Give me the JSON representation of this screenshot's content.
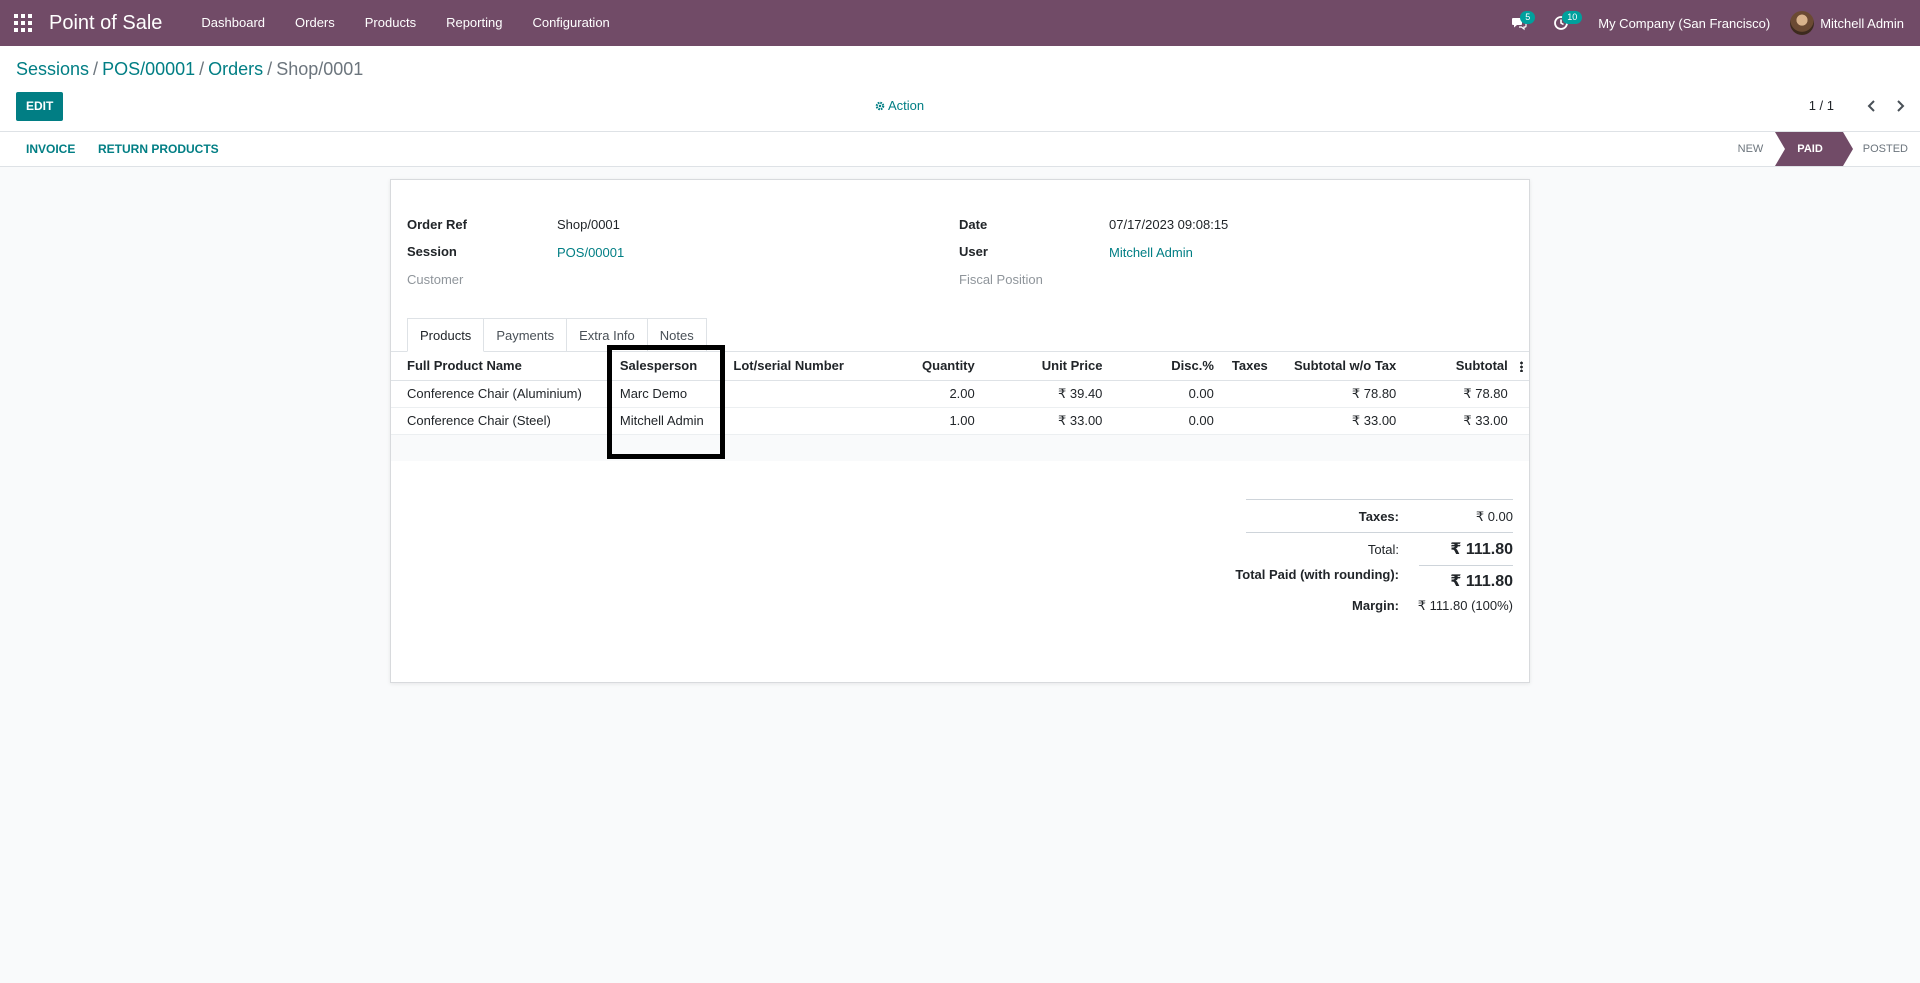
{
  "navbar": {
    "app_name": "Point of Sale",
    "menu": [
      "Dashboard",
      "Orders",
      "Products",
      "Reporting",
      "Configuration"
    ],
    "messages_count": "5",
    "activities_count": "10",
    "company": "My Company (San Francisco)",
    "user": "Mitchell Admin",
    "color": "#714b67"
  },
  "breadcrumb": {
    "items": [
      "Sessions",
      "POS/00001",
      "Orders"
    ],
    "separator": "/",
    "current": "Shop/0001"
  },
  "toolbar": {
    "edit_label": "EDIT",
    "action_label": "Action",
    "pager": "1 / 1"
  },
  "statusbar": {
    "buttons": [
      "INVOICE",
      "RETURN PRODUCTS"
    ],
    "stages": [
      "NEW",
      "PAID",
      "POSTED"
    ],
    "current_stage": "PAID"
  },
  "form": {
    "order_ref_label": "Order Ref",
    "order_ref": "Shop/0001",
    "session_label": "Session",
    "session": "POS/00001",
    "customer_label": "Customer",
    "date_label": "Date",
    "date": "07/17/2023 09:08:15",
    "user_label": "User",
    "user": "Mitchell Admin",
    "fiscal_position_label": "Fiscal Position"
  },
  "tabs": [
    "Products",
    "Payments",
    "Extra Info",
    "Notes"
  ],
  "active_tab": "Products",
  "lines": {
    "columns": [
      "Full Product Name",
      "Salesperson",
      "Lot/serial Number",
      "Quantity",
      "Unit Price",
      "Disc.%",
      "Taxes",
      "Subtotal w/o Tax",
      "Subtotal"
    ],
    "rows": [
      {
        "product": "Conference Chair (Aluminium)",
        "salesperson": "Marc Demo",
        "lot": "",
        "qty": "2.00",
        "unit_price": "₹ 39.40",
        "disc": "0.00",
        "taxes": "",
        "subtotal_wo_tax": "₹ 78.80",
        "subtotal": "₹ 78.80"
      },
      {
        "product": "Conference Chair (Steel)",
        "salesperson": "Mitchell Admin",
        "lot": "",
        "qty": "1.00",
        "unit_price": "₹ 33.00",
        "disc": "0.00",
        "taxes": "",
        "subtotal_wo_tax": "₹ 33.00",
        "subtotal": "₹ 33.00"
      }
    ]
  },
  "totals": {
    "taxes_label": "Taxes:",
    "taxes": "₹ 0.00",
    "total_label": "Total:",
    "total": "₹ 111.80",
    "paid_label": "Total Paid (with rounding):",
    "paid": "₹ 111.80",
    "margin_label": "Margin:",
    "margin": "₹ 111.80 (100%)"
  }
}
